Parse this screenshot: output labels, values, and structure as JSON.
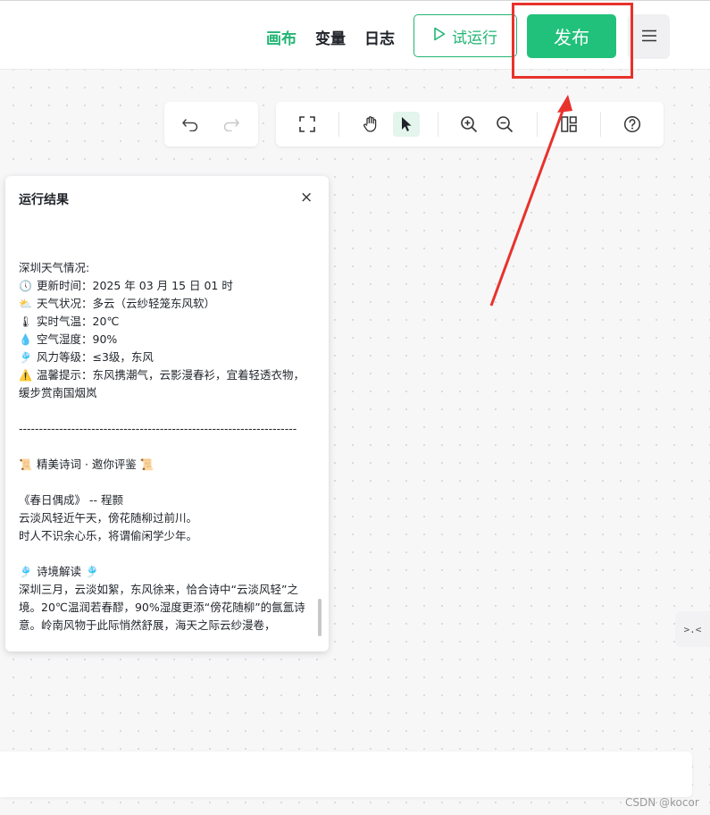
{
  "header": {
    "tabs": [
      {
        "label": "画布",
        "active": true
      },
      {
        "label": "变量",
        "active": false
      },
      {
        "label": "日志",
        "active": false
      }
    ],
    "trial_run_label": "试运行",
    "publish_label": "发布",
    "accent_color": "#22b573",
    "highlight_color": "#e8322c"
  },
  "toolbar": {
    "history_tools": [
      "undo-icon",
      "redo-icon"
    ],
    "main_tools": [
      "fullscreen-icon",
      "hand-icon",
      "pointer-icon",
      "zoom-in-icon",
      "zoom-out-icon",
      "layout-icon",
      "help-icon"
    ],
    "selected_tool": "pointer-icon"
  },
  "run_result": {
    "title": "运行结果",
    "close_glyph": "×",
    "lines": [
      {
        "icon": "",
        "text": ""
      },
      {
        "icon": "",
        "text": "深圳天气情况:"
      },
      {
        "icon": "🕔",
        "text": "更新时间：2025 年 03 月 15 日 01 时"
      },
      {
        "icon": "⛅",
        "text": "天气状况：多云（云纱轻笼东风软）"
      },
      {
        "icon": "🌡",
        "text": "实时气温：20℃"
      },
      {
        "icon": "💧",
        "text": "空气湿度：90%"
      },
      {
        "icon": "🎐",
        "text": "风力等级：≤3级，东风"
      },
      {
        "icon": "⚠️",
        "text": "温馨提示：东风携潮气，云影漫春衫，宜着轻透衣物，缓步赏南国烟岚"
      },
      {
        "icon": "",
        "text": ""
      },
      {
        "icon": "",
        "text": "---------------------------------------------------------------------"
      },
      {
        "icon": "",
        "text": ""
      },
      {
        "icon": "📜",
        "text": "精美诗词 · 邀你评鉴 📜"
      },
      {
        "icon": "",
        "text": ""
      },
      {
        "icon": "",
        "text": "《春日偶成》 -- 程颢"
      },
      {
        "icon": "",
        "text": "云淡风轻近午天，傍花随柳过前川。"
      },
      {
        "icon": "",
        "text": "时人不识余心乐，将谓偷闲学少年。"
      },
      {
        "icon": "",
        "text": ""
      },
      {
        "icon": "🎐",
        "text": "诗境解读 🎐"
      },
      {
        "icon": "",
        "text": "深圳三月，云淡如絮，东风徐来，恰合诗中“云淡风轻”之境。20℃温润若春醪，90%湿度更添“傍花随柳”的氤氲诗意。岭南风物于此际悄然舒展，海天之际云纱漫卷，"
      }
    ]
  },
  "side_widget": {
    "label": ">.<"
  },
  "watermark": "CSDN @kocor"
}
